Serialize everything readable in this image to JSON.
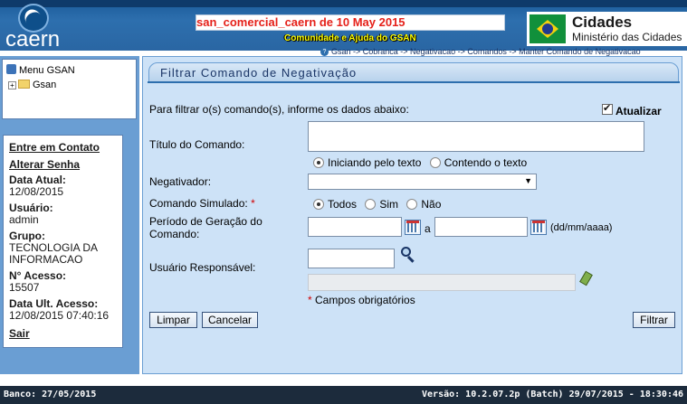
{
  "header": {
    "logo_text": "caern",
    "title": "san_comercial_caern de 10 May 2015",
    "community_link": "Comunidade e Ajuda do GSAN",
    "cidades_title": "Cidades",
    "cidades_subtitle": "Ministério das Cidades"
  },
  "breadcrumb": "Gsan -> Cobranca -> Negativacao -> Comandos -> Manter Comando de Negativacao",
  "sidebar": {
    "menu_title": "Menu GSAN",
    "tree_root": "Gsan",
    "contact_link": "Entre em Contato",
    "password_link": "Alterar Senha",
    "date_label": "Data Atual:",
    "date_value": "12/08/2015",
    "user_label": "Usuário:",
    "user_value": "admin",
    "group_label": "Grupo:",
    "group_value": "TECNOLOGIA DA INFORMACAO",
    "access_label": "N° Acesso:",
    "access_value": "15507",
    "last_access_label": "Data Ult. Acesso:",
    "last_access_value": "12/08/2015 07:40:16",
    "logout_link": "Sair"
  },
  "form": {
    "panel_title": "Filtrar Comando de Negativação",
    "intro_text": "Para filtrar o(s) comando(s), informe os dados abaixo:",
    "update_label": "Atualizar",
    "update_checked": true,
    "title_label": "Título do Comando:",
    "title_value": "",
    "title_match_options": [
      "Iniciando pelo texto",
      "Contendo o texto"
    ],
    "title_match_selected": "Iniciando pelo texto",
    "negativador_label": "Negativador:",
    "negativador_value": "",
    "simulado_label": "Comando Simulado:",
    "simulado_required_mark": "*",
    "simulado_options": [
      "Todos",
      "Sim",
      "Não"
    ],
    "simulado_selected": "Todos",
    "periodo_label_line1": "Período de Geração do",
    "periodo_label_line2": "Comando:",
    "periodo_start": "",
    "periodo_sep": "a",
    "periodo_end": "",
    "periodo_format": "(dd/mm/aaaa)",
    "usuario_label": "Usuário Responsável:",
    "usuario_code": "",
    "usuario_name": "",
    "required_note_mark": "*",
    "required_note": "Campos obrigatórios",
    "clear_button": "Limpar",
    "cancel_button": "Cancelar",
    "filter_button": "Filtrar"
  },
  "footer": {
    "banco": "Banco: 27/05/2015",
    "versao": "Versão: 10.2.07.2p (Batch) 29/07/2015 - 18:30:46"
  }
}
